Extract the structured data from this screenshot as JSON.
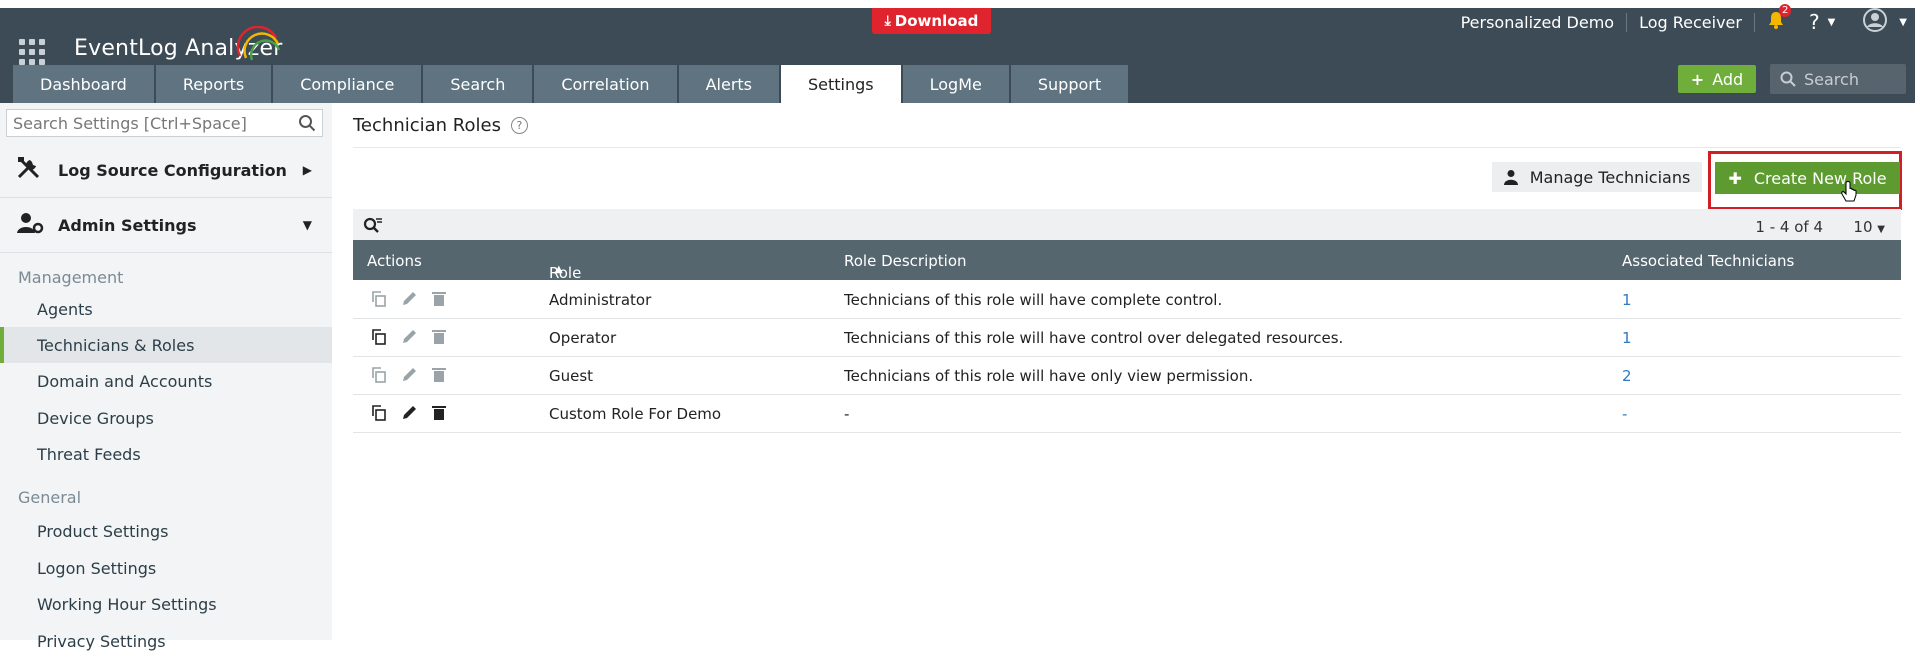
{
  "header": {
    "app_name": "EventLog Analyzer",
    "download_label": "Download",
    "links": [
      "Personalized Demo",
      "Log Receiver"
    ],
    "notification_count": "2",
    "help_label": "?",
    "add_label": "Add",
    "search_placeholder": "Search"
  },
  "tabs": [
    "Dashboard",
    "Reports",
    "Compliance",
    "Search",
    "Correlation",
    "Alerts",
    "Settings",
    "LogMe",
    "Support"
  ],
  "active_tab": "Settings",
  "sidebar": {
    "search_placeholder": "Search Settings [Ctrl+Space]",
    "sections": [
      "Log Source Configuration",
      "Admin Settings"
    ],
    "groups": {
      "management": "Management",
      "general": "General"
    },
    "management_items": [
      "Agents",
      "Technicians & Roles",
      "Domain and Accounts",
      "Device Groups",
      "Threat Feeds"
    ],
    "general_items": [
      "Product Settings",
      "Logon Settings",
      "Working Hour Settings",
      "Privacy Settings"
    ]
  },
  "main": {
    "title": "Technician Roles",
    "manage_label": "Manage Technicians",
    "create_label": "Create New Role",
    "pager": "1 - 4 of 4",
    "per_page": "10",
    "columns": [
      "Actions",
      "Role Name",
      "Role Description",
      "Associated Technicians"
    ],
    "rows": [
      {
        "name": "Administrator",
        "desc": "Technicians of this role will have complete control.",
        "assoc": "1"
      },
      {
        "name": "Operator",
        "desc": "Technicians of this role will have control over delegated resources.",
        "assoc": "1"
      },
      {
        "name": "Guest",
        "desc": "Technicians of this role will have only view permission.",
        "assoc": "2"
      },
      {
        "name": "Custom Role For Demo",
        "desc": "-",
        "assoc": "-"
      }
    ]
  },
  "colors": {
    "header_bg": "#3c4b55",
    "tab_bg": "#5f7380",
    "accent_green": "#6fae3b",
    "download_red": "#e0242e",
    "highlight_red": "#d21f26",
    "link_blue": "#2d7bc4"
  }
}
